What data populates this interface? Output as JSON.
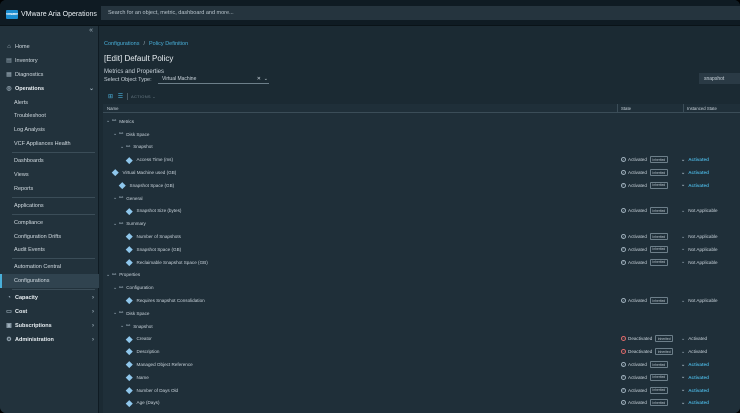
{
  "app": {
    "logo_text": "vmware",
    "name": "VMware Aria Operations"
  },
  "search": {
    "placeholder": "Search for an object, metric, dashboard and more..."
  },
  "sidebar": {
    "items": [
      {
        "label": "Home",
        "icon": "home-icon"
      },
      {
        "label": "Inventory",
        "icon": "inventory-icon"
      },
      {
        "label": "Diagnostics",
        "icon": "diagnostics-icon"
      },
      {
        "label": "Operations",
        "icon": "operations-icon",
        "expanded": true
      },
      {
        "label": "Alerts"
      },
      {
        "label": "Troubleshoot"
      },
      {
        "label": "Log Analysis"
      },
      {
        "label": "VCF Appliances Health"
      },
      {
        "label": "Dashboards"
      },
      {
        "label": "Views"
      },
      {
        "label": "Reports"
      },
      {
        "label": "Applications"
      },
      {
        "label": "Compliance"
      },
      {
        "label": "Configuration Drifts"
      },
      {
        "label": "Audit Events"
      },
      {
        "label": "Automation Central"
      },
      {
        "label": "Configurations",
        "active": true
      },
      {
        "label": "Capacity",
        "icon": "capacity-icon"
      },
      {
        "label": "Cost",
        "icon": "cost-icon"
      },
      {
        "label": "Subscriptions",
        "icon": "subscriptions-icon"
      },
      {
        "label": "Administration",
        "icon": "administration-icon"
      }
    ]
  },
  "breadcrumb": {
    "items": [
      "Configurations",
      "Policy Definition"
    ],
    "separator": "/"
  },
  "page": {
    "title": "[Edit] Default Policy",
    "section": "Metrics and Properties",
    "object_type_label": "Select Object Type:",
    "object_type_value": "Virtual Machine",
    "filter_value": "snapshot"
  },
  "toolbar": {
    "actions_label": "ACTIONS"
  },
  "grid": {
    "columns": {
      "name": "Name",
      "state": "State",
      "instanced_state": "Instanced State"
    },
    "rows": [
      {
        "name": "Metrics",
        "kind": "group"
      },
      {
        "name": "Disk Space",
        "kind": "group"
      },
      {
        "name": "Snapshot",
        "kind": "group"
      },
      {
        "name": "Access Time (ms)",
        "kind": "leaf",
        "state": "Activated",
        "badge": "Inherited",
        "instanced": "Activated"
      },
      {
        "name": "Virtual Machine used (GB)",
        "kind": "leaf",
        "state": "Activated",
        "badge": "Inherited",
        "instanced": "Activated"
      },
      {
        "name": "Snapshot Space (GB)",
        "kind": "leaf",
        "state": "Activated",
        "badge": "Inherited",
        "instanced": "Activated"
      },
      {
        "name": "General",
        "kind": "group"
      },
      {
        "name": "Snapshot Size (bytes)",
        "kind": "leaf",
        "state": "Activated",
        "badge": "Inherited",
        "instanced": "Not Applicable"
      },
      {
        "name": "Summary",
        "kind": "group"
      },
      {
        "name": "Number of Snapshots",
        "kind": "leaf",
        "state": "Activated",
        "badge": "Inherited",
        "instanced": "Not Applicable"
      },
      {
        "name": "Snapshot Space (GB)",
        "kind": "leaf",
        "state": "Activated",
        "badge": "Inherited",
        "instanced": "Not Applicable"
      },
      {
        "name": "Reclaimable Snapshot Space (GB)",
        "kind": "leaf",
        "state": "Activated",
        "badge": "Inherited",
        "instanced": "Not Applicable"
      },
      {
        "name": "Properties",
        "kind": "group"
      },
      {
        "name": "Configuration",
        "kind": "group"
      },
      {
        "name": "Requires Snapshot Consolidation",
        "kind": "leaf",
        "state": "Activated",
        "badge": "Inherited",
        "instanced": "Not Applicable"
      },
      {
        "name": "Disk Space",
        "kind": "group"
      },
      {
        "name": "Snapshot",
        "kind": "group"
      },
      {
        "name": "Creator",
        "kind": "leaf",
        "state": "Deactivated",
        "badge": "Inherited",
        "instanced": "Activated"
      },
      {
        "name": "Description",
        "kind": "leaf",
        "state": "Deactivated",
        "badge": "Inherited",
        "instanced": "Activated"
      },
      {
        "name": "Managed Object Reference",
        "kind": "leaf",
        "state": "Activated",
        "badge": "Inherited",
        "instanced": "Activated"
      },
      {
        "name": "Name",
        "kind": "leaf",
        "state": "Activated",
        "badge": "Inherited",
        "instanced": "Activated"
      },
      {
        "name": "Number of Days Old",
        "kind": "leaf",
        "state": "Activated",
        "badge": "Inherited",
        "instanced": "Activated"
      },
      {
        "name": "Age (Days)",
        "kind": "leaf",
        "state": "Activated",
        "badge": "Inherited",
        "instanced": "Activated"
      }
    ]
  },
  "colors": {
    "accent": "#49afd9",
    "header_bg": "#0f1b23",
    "sidebar_bg": "#22323c",
    "main_bg": "#1b2a33",
    "deactivated": "#e06b6b"
  }
}
